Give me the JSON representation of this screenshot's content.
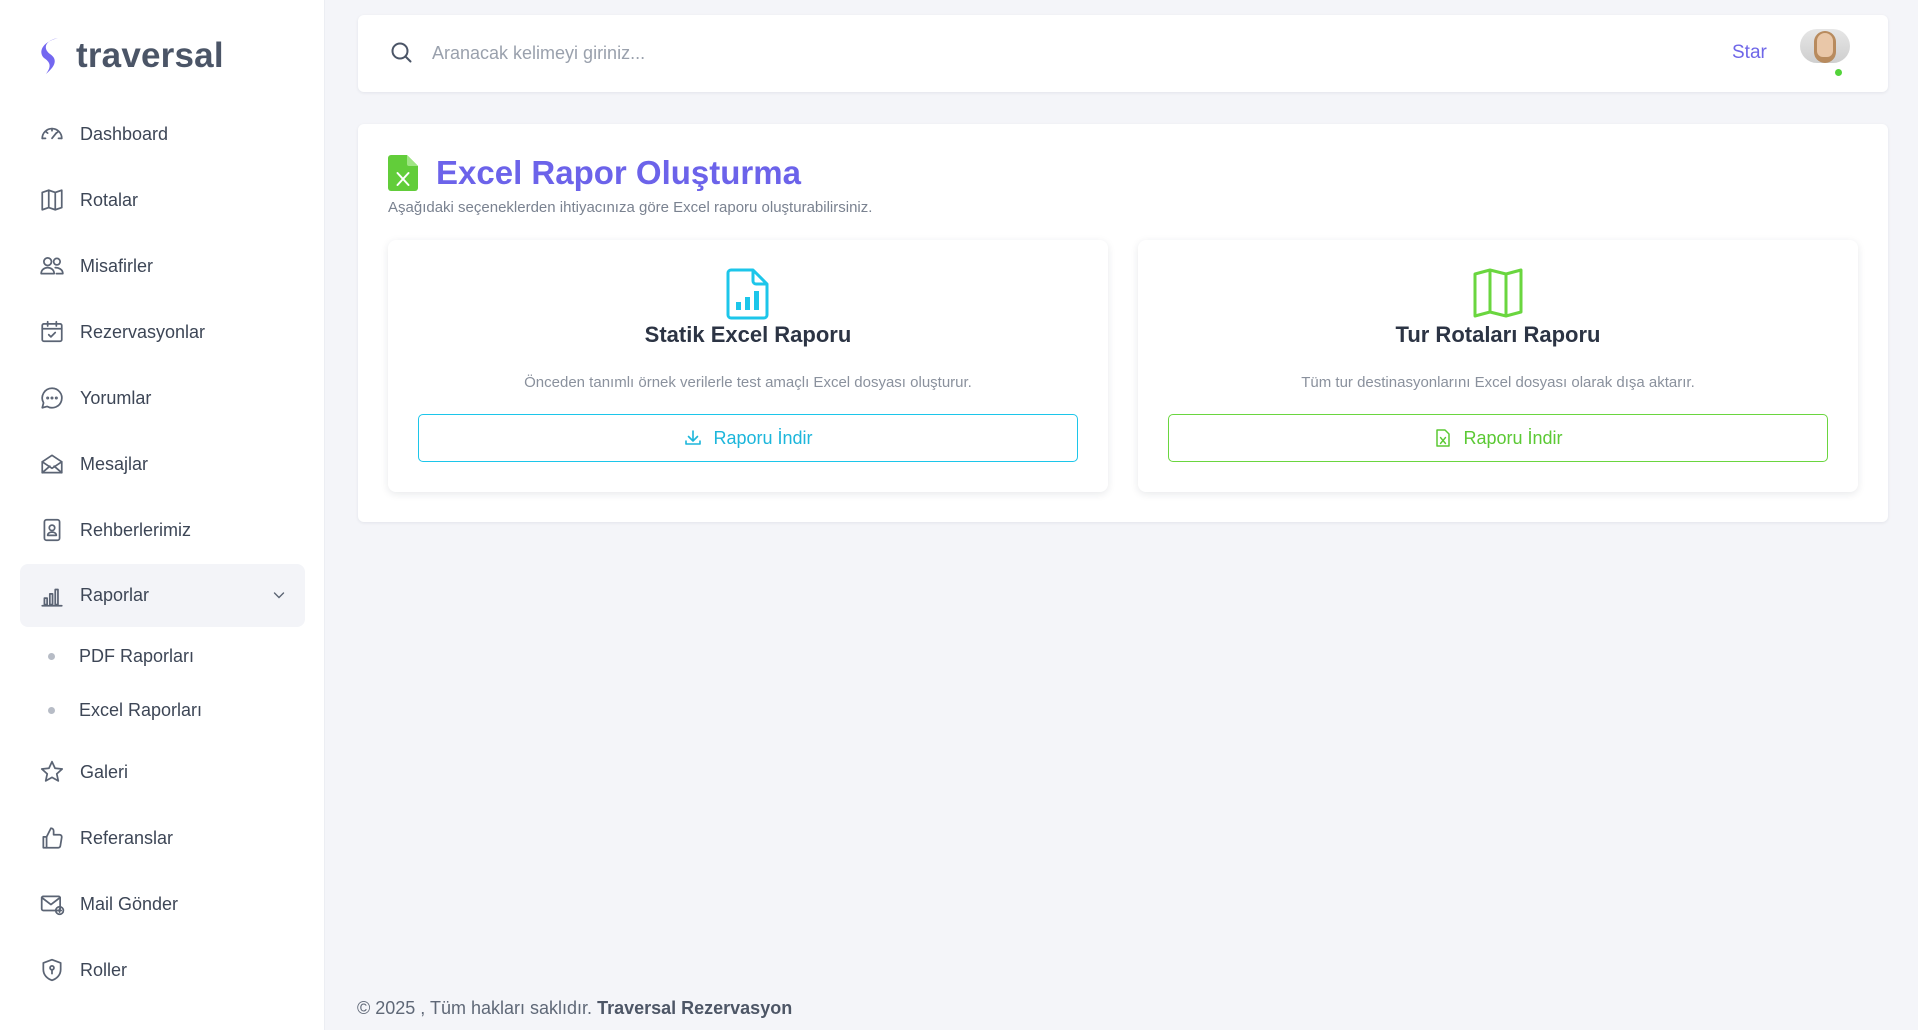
{
  "brand": {
    "name": "traversal"
  },
  "sidebar": {
    "items": [
      {
        "label": "Dashboard",
        "icon": "dashboard-icon"
      },
      {
        "label": "Rotalar",
        "icon": "map-icon"
      },
      {
        "label": "Misafirler",
        "icon": "users-icon"
      },
      {
        "label": "Rezervasyonlar",
        "icon": "calendar-check-icon"
      },
      {
        "label": "Yorumlar",
        "icon": "chat-icon"
      },
      {
        "label": "Mesajlar",
        "icon": "mail-open-icon"
      },
      {
        "label": "Rehberlerimiz",
        "icon": "id-badge-icon"
      },
      {
        "label": "Raporlar",
        "icon": "bar-chart-icon"
      },
      {
        "label": "Galeri",
        "icon": "star-icon"
      },
      {
        "label": "Referanslar",
        "icon": "thumbs-up-icon"
      },
      {
        "label": "Mail Gönder",
        "icon": "mail-send-icon"
      },
      {
        "label": "Roller",
        "icon": "shield-icon"
      }
    ],
    "reports_submenu": [
      {
        "label": "PDF Raporları"
      },
      {
        "label": "Excel Raporları"
      }
    ]
  },
  "topbar": {
    "search_placeholder": "Aranacak kelimeyi giriniz...",
    "user_link": "Star"
  },
  "main": {
    "title": "Excel Rapor Oluşturma",
    "subtitle": "Aşağıdaki seçeneklerden ihtiyacınıza göre Excel raporu oluşturabilirsiniz.",
    "cards": [
      {
        "title": "Statik Excel Raporu",
        "description": "Önceden tanımlı örnek verilerle test amaçlı Excel dosyası oluşturur.",
        "button_label": "Raporu İndir",
        "accent": "#1cc6ea"
      },
      {
        "title": "Tur Rotaları Raporu",
        "description": "Tüm tur destinasyonlarını Excel dosyası olarak dışa aktarır.",
        "button_label": "Raporu İndir",
        "accent": "#6ad63f"
      }
    ]
  },
  "footer": {
    "prefix": "© 2025 , Tüm hakları saklıdır.",
    "company": "Traversal Rezervasyon"
  },
  "colors": {
    "primary": "#6c63ea",
    "cyan": "#1cc6ea",
    "green": "#6ad63f",
    "status_online": "#53d33a"
  }
}
